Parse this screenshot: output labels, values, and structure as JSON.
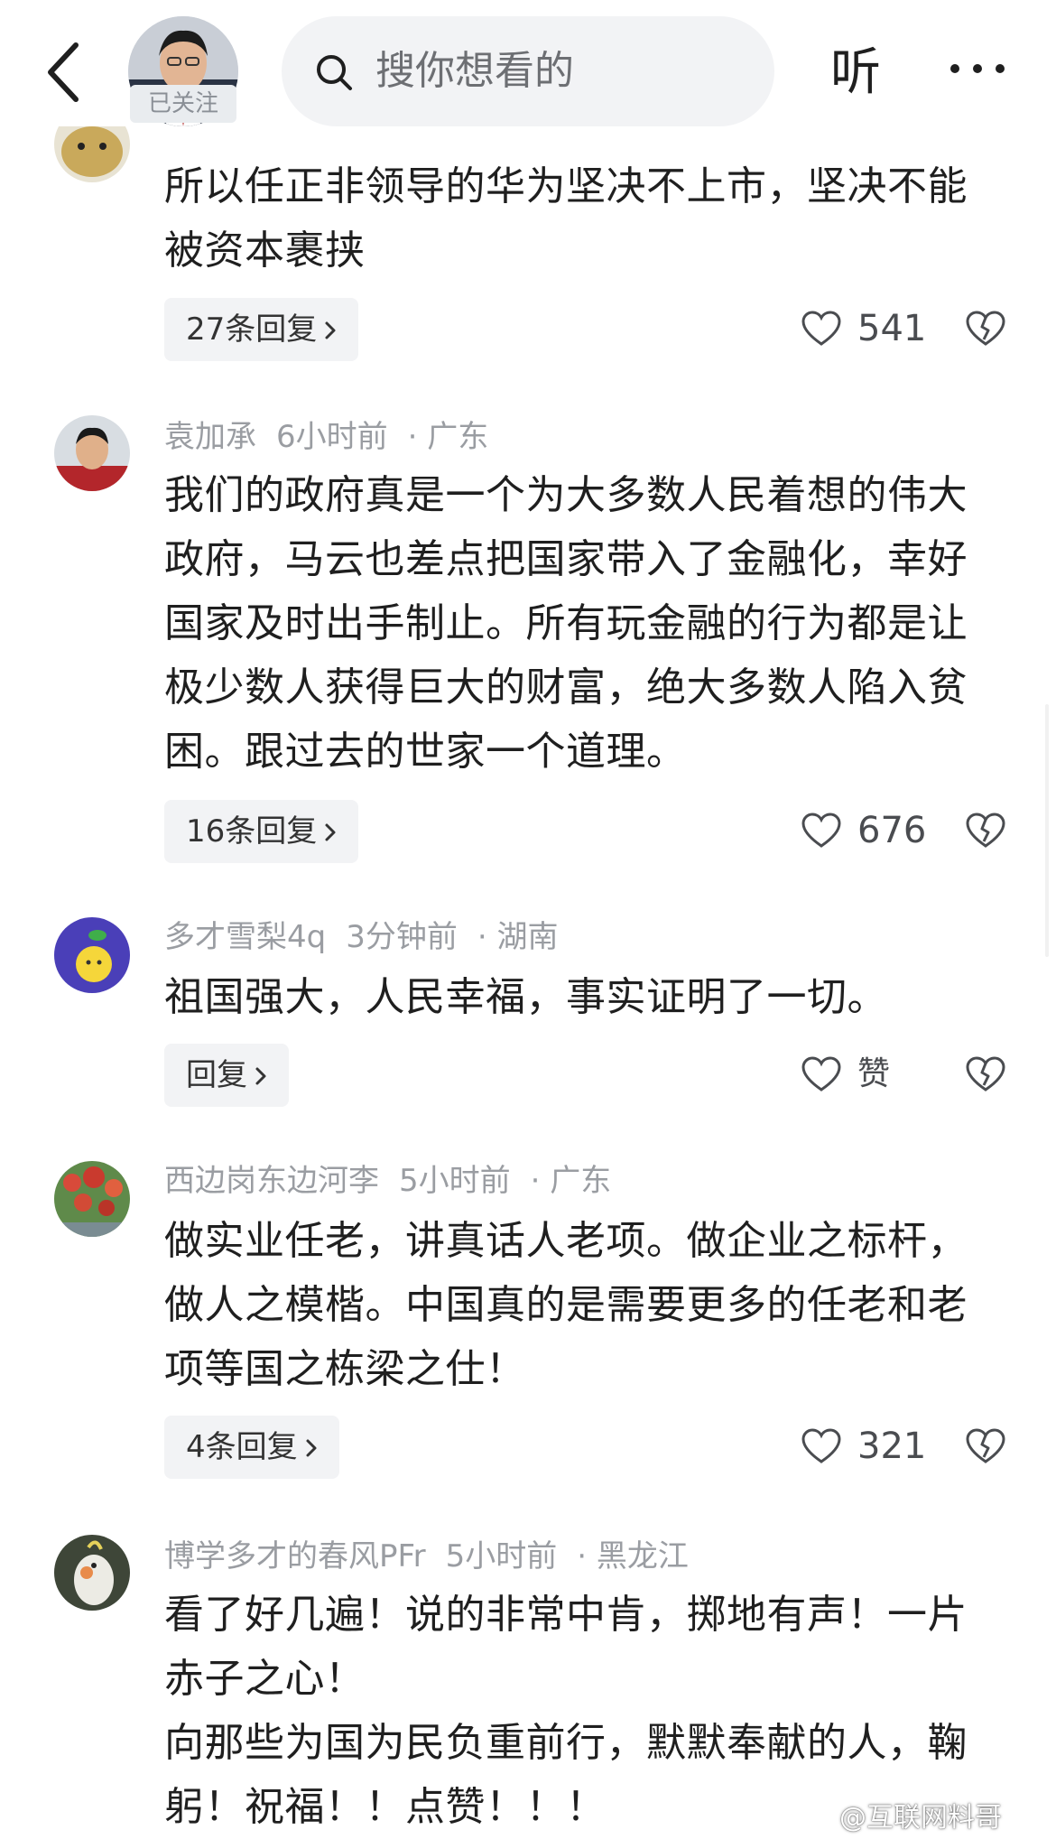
{
  "header": {
    "follow_badge": "已关注",
    "search_placeholder": "搜你想看的",
    "listen_label": "听"
  },
  "comments": [
    {
      "user": "",
      "time": "",
      "location": "",
      "text": "所以任正非领导的华为坚决不上市，坚决不能被资本裹挟",
      "reply_label": "27条回复",
      "likes": "541"
    },
    {
      "user": "袁加承",
      "time": "6小时前",
      "location": "· 广东",
      "text": "我们的政府真是一个为大多数人民着想的伟大政府，马云也差点把国家带入了金融化，幸好国家及时出手制止。所有玩金融的行为都是让极少数人获得巨大的财富，绝大多数人陷入贫困。跟过去的世家一个道理。",
      "reply_label": "16条回复",
      "likes": "676"
    },
    {
      "user": "多才雪梨4q",
      "time": "3分钟前",
      "location": "· 湖南",
      "text": "祖国强大，人民幸福，事实证明了一切。",
      "reply_label": "回复",
      "likes": "赞"
    },
    {
      "user": "西边岗东边河李",
      "time": "5小时前",
      "location": "· 广东",
      "text": "做实业任老，讲真话人老项。做企业之标杆，做人之模楷。中国真的是需要更多的任老和老项等国之栋梁之仕！",
      "reply_label": "4条回复",
      "likes": "321"
    },
    {
      "user": "博学多才的春风PFr",
      "time": "5小时前",
      "location": "· 黑龙江",
      "text": "看了好几遍！说的非常中肯，掷地有声！一片赤子之心！\n向那些为国为民负重前行，默默奉献的人，鞠躬！祝福！！点赞！！！",
      "reply_label": "",
      "likes": ""
    }
  ],
  "watermark": "@互联网料哥",
  "colors": {
    "meta_gray": "#9a9da2",
    "reply_bg": "#f2f3f5",
    "text_dark": "#1f1f1f"
  }
}
